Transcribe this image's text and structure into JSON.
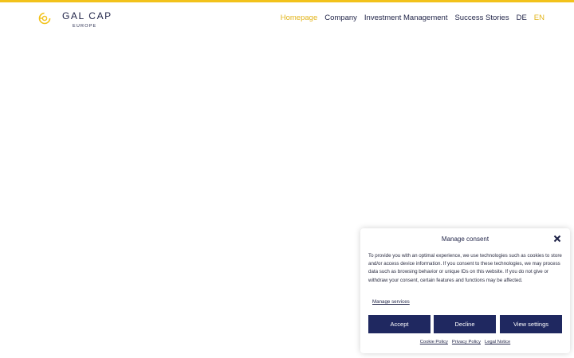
{
  "brand": {
    "name": "GAL CAP",
    "sub": "EUROPE",
    "accent_color": "#f2c21b",
    "text_color": "#1f2347"
  },
  "nav": {
    "items": [
      {
        "label": "Homepage",
        "active": true
      },
      {
        "label": "Company",
        "active": false
      },
      {
        "label": "Investment Management",
        "active": false
      },
      {
        "label": "Success Stories",
        "active": false
      },
      {
        "label": "DE",
        "active": false
      },
      {
        "label": "EN",
        "active": true
      }
    ]
  },
  "consent": {
    "title": "Manage consent",
    "close_icon": "close-icon",
    "text": "To provide you with an optimal experience, we use technologies such as cookies to store and/or access device information. If you consent to these technologies, we may process data such as browsing behavior or unique IDs on this website. If you do not give or withdraw your consent, certain features and functions may be affected.",
    "manage_services": "Manage services",
    "buttons": {
      "accept": "Accept",
      "decline": "Decline",
      "view_settings": "View settings"
    },
    "button_color": "#1f2860",
    "links": {
      "cookie_policy": "Cookie Policy",
      "privacy_policy": "Privacy Policy",
      "legal_notice": "Legal Notice"
    }
  }
}
